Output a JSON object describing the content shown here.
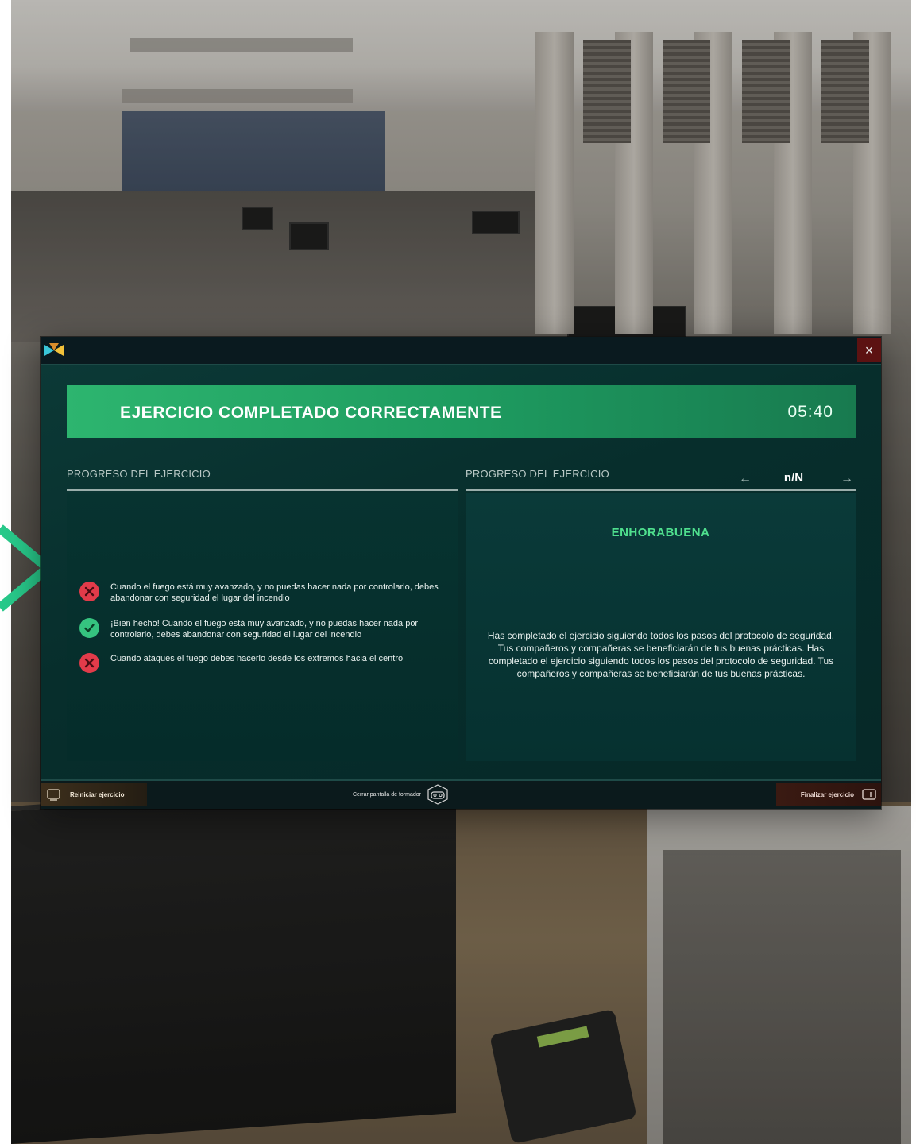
{
  "colors": {
    "accent_green": "#2db56f",
    "success_text": "#4fe08e",
    "error_red": "#e23b4a",
    "ok_green": "#35c37f",
    "modal_bg": "#072e2c",
    "close_bg": "#5c1212"
  },
  "modal": {
    "close_icon": "×",
    "banner": {
      "title": "EJERCICIO COMPLETADO CORRECTAMENTE",
      "timer": "05:40"
    },
    "left": {
      "section_title": "PROGRESO DEL EJERCICIO",
      "items": [
        {
          "status": "error",
          "icon": "x-circle-icon",
          "text": "Cuando el fuego está muy avanzado, y no puedas hacer nada por controlarlo, debes abandonar con seguridad el lugar del incendio"
        },
        {
          "status": "success",
          "icon": "check-circle-icon",
          "text": "¡Bien hecho! Cuando el fuego está muy avanzado, y no puedas hacer nada por controlarlo, debes abandonar con seguridad el lugar del incendio"
        },
        {
          "status": "error",
          "icon": "x-circle-icon",
          "text": "Cuando ataques el fuego debes hacerlo desde los extremos hacia el centro"
        }
      ]
    },
    "right": {
      "section_title": "PROGRESO DEL EJERCICIO",
      "pager": {
        "prev": "←",
        "count": "n/N",
        "next": "→"
      },
      "heading": "ENHORABUENA",
      "body": "Has completado el ejercicio siguiendo todos los pasos del protocolo de seguridad. Tus compañeros y compañeras se beneficiarán de tus buenas prácticas. Has completado el ejercicio siguiendo todos los pasos del protocolo de seguridad. Tus compañeros y compañeras se beneficiarán de tus buenas prácticas."
    },
    "footer": {
      "restart_label": "Reiniciar ejercicio",
      "close_trainer_label": "Cerrar pantalla de formador",
      "finish_label": "Finalizar ejercicio"
    }
  }
}
